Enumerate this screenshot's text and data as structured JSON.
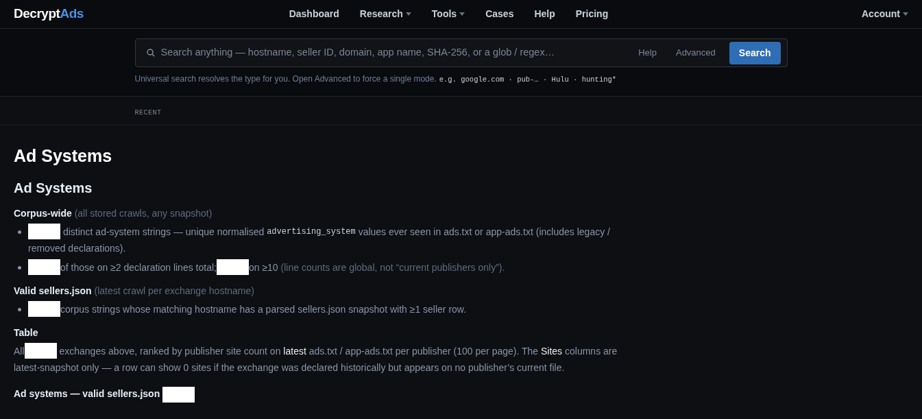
{
  "brand": {
    "first": "Decrypt",
    "second": "Ads"
  },
  "nav": [
    {
      "label": "Dashboard",
      "dropdown": false
    },
    {
      "label": "Research",
      "dropdown": true
    },
    {
      "label": "Tools",
      "dropdown": true
    },
    {
      "label": "Cases",
      "dropdown": false
    },
    {
      "label": "Help",
      "dropdown": false
    },
    {
      "label": "Pricing",
      "dropdown": false
    }
  ],
  "account": {
    "label": "Account",
    "dropdown": true
  },
  "search": {
    "placeholder": "Search anything — hostname, seller ID, domain, app name, SHA-256, or a glob / regex…",
    "links": [
      "Help",
      "Advanced"
    ],
    "button": "Search",
    "hint": "Universal search resolves the type for you. Open Advanced to force a single mode.",
    "examples": "e.g. google.com · pub-… · Hulu · hunting*"
  },
  "recent": "RECENT",
  "title": "Ad Systems",
  "section": "Ad Systems",
  "blocks": [
    {
      "kind": "heading",
      "parts": [
        {
          "kind": "strong",
          "text": "Corpus-wide"
        },
        {
          "kind": "muted",
          "text": " (all stored crawls, any snapshot)"
        }
      ]
    },
    {
      "kind": "bullet",
      "lines": [
        [
          {
            "kind": "redacted"
          },
          {
            "kind": "text",
            "text": " distinct ad-system strings — unique normalised "
          },
          {
            "kind": "code",
            "text": "advertising_system"
          },
          {
            "kind": "text",
            "text": " values ever seen in ads.txt or app-ads.txt (includes legacy /"
          }
        ],
        [
          {
            "kind": "text",
            "text": "removed declarations)."
          }
        ]
      ]
    },
    {
      "kind": "bullet",
      "parts": [
        {
          "kind": "redacted"
        },
        {
          "kind": "text",
          "text": "of those on ≥2 declaration lines total;"
        },
        {
          "kind": "redacted"
        },
        {
          "kind": "text",
          "text": "on ≥10 "
        },
        {
          "kind": "muted",
          "text": "(line counts are global, not “current publishers only”)."
        }
      ]
    },
    {
      "kind": "heading",
      "parts": [
        {
          "kind": "strong",
          "text": "Valid sellers.json"
        },
        {
          "kind": "muted",
          "text": " (latest crawl per exchange hostname)"
        }
      ]
    },
    {
      "kind": "bullet",
      "parts": [
        {
          "kind": "redacted"
        },
        {
          "kind": "text",
          "text": "corpus strings whose matching hostname has a parsed sellers.json snapshot with ≥1 seller row."
        }
      ]
    },
    {
      "kind": "heading",
      "parts": [
        {
          "kind": "strong",
          "text": "Table"
        }
      ]
    },
    {
      "kind": "paragraph",
      "lines": [
        [
          {
            "kind": "text",
            "text": "All"
          },
          {
            "kind": "redacted"
          },
          {
            "kind": "text",
            "text": " exchanges above, ranked by publisher site count on "
          },
          {
            "kind": "emph",
            "text": "latest"
          },
          {
            "kind": "text",
            "text": " ads.txt / app-ads.txt per publisher (100 per page). The "
          },
          {
            "kind": "emph",
            "text": "Sites"
          },
          {
            "kind": "text",
            "text": " columns are"
          }
        ],
        [
          {
            "kind": "text",
            "text": "latest-snapshot only — a row can show 0 sites if the exchange was declared historically but appears on no publisher’s current file."
          }
        ]
      ]
    },
    {
      "kind": "subheading",
      "parts": [
        {
          "kind": "strong",
          "text": "Ad systems — valid sellers.json "
        },
        {
          "kind": "redacted"
        }
      ]
    }
  ]
}
